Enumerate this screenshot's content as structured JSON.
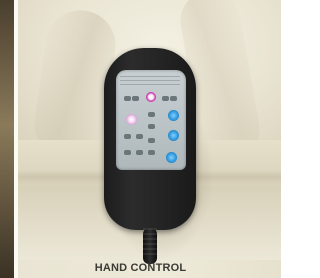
{
  "caption": {
    "text": "HAND CONTROL"
  },
  "colors": {
    "remote_body": "#1c1c1c",
    "panel": "#c8cfd2",
    "button_blue": "#2a93d8",
    "button_power": "#d23bb0",
    "button_pink": "#c468c0",
    "upholstery": "#eeead9"
  },
  "icons": {
    "power": "power-icon"
  }
}
